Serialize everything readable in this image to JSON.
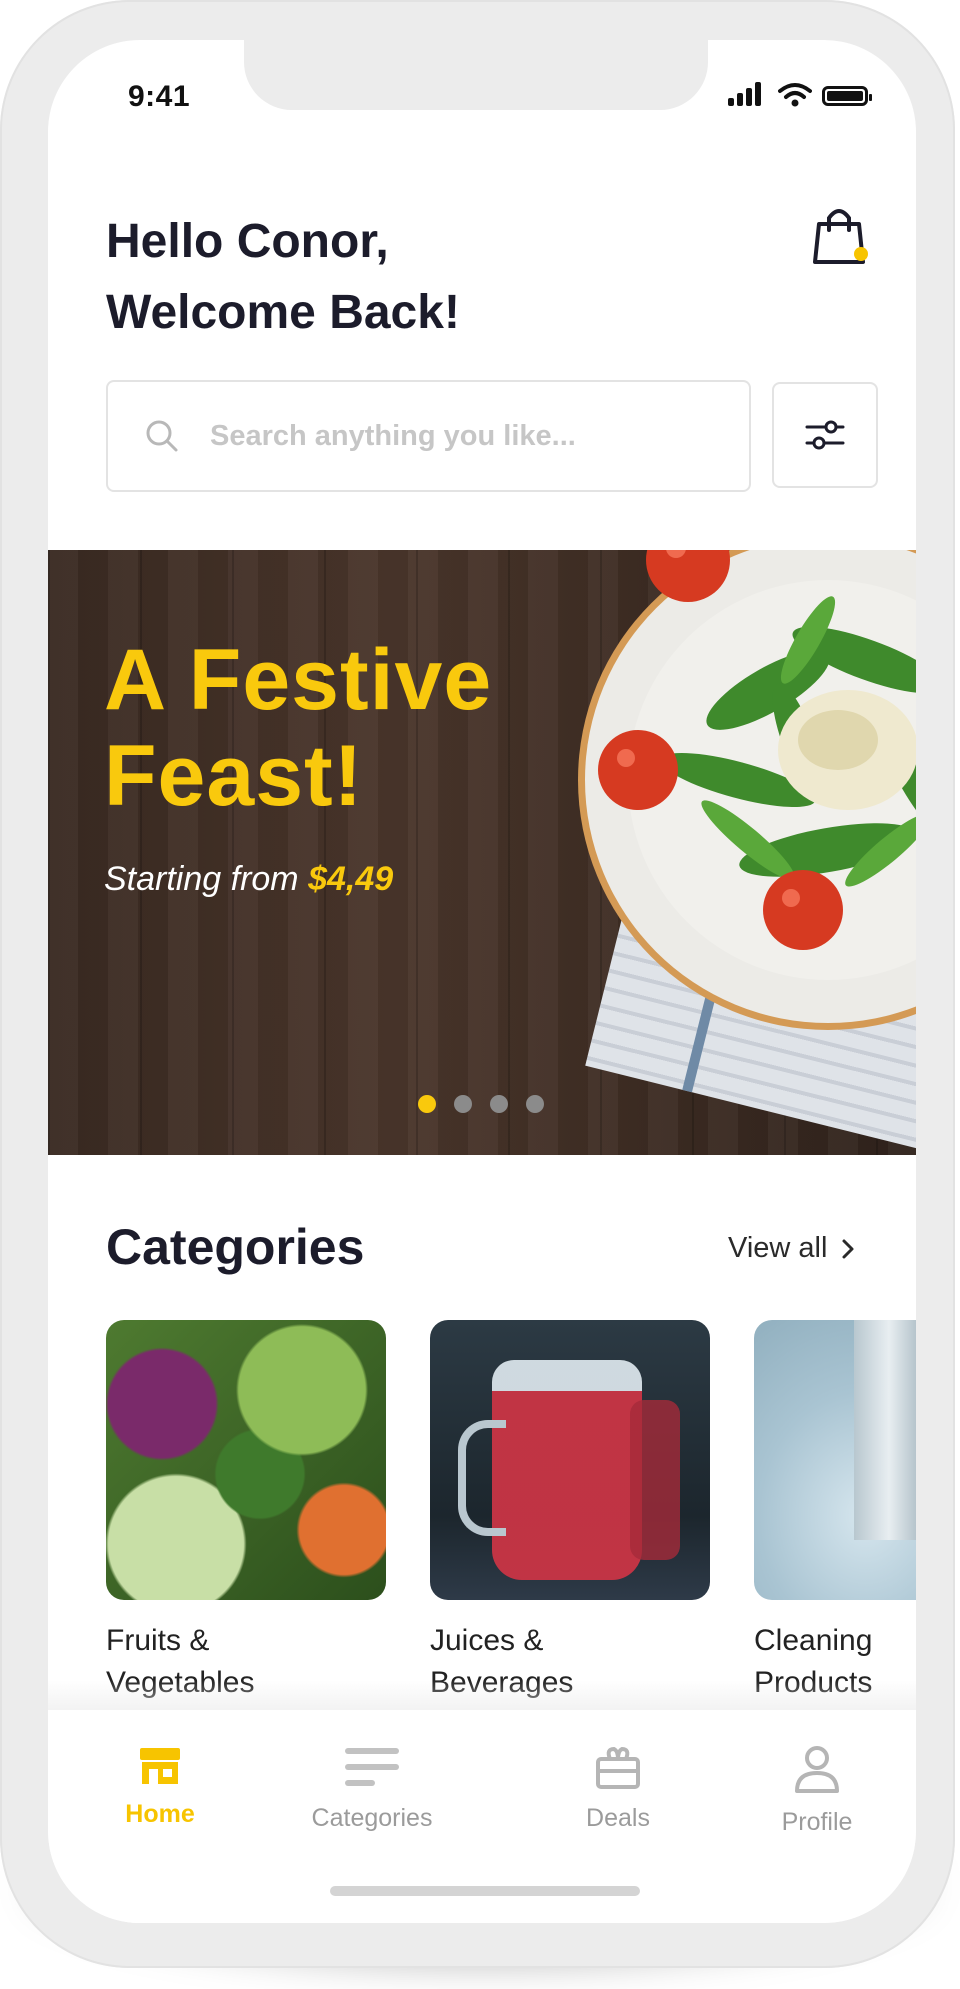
{
  "status_bar": {
    "time": "9:41"
  },
  "header": {
    "greeting_line1": "Hello Conor,",
    "greeting_line2": "Welcome Back!",
    "cart_icon": "shopping-bag-icon"
  },
  "search": {
    "placeholder": "Search anything you like...",
    "value": "",
    "filter_icon": "sliders-icon"
  },
  "banner": {
    "title_line1": "A Festive",
    "title_line2": "Feast!",
    "subtitle": "Starting from",
    "price": "$4,49",
    "slides": 4,
    "active_slide": 1
  },
  "categories": {
    "title": "Categories",
    "view_all": "View all",
    "items": [
      {
        "line1": "Fruits &",
        "line2": "Vegetables"
      },
      {
        "line1": "Juices &",
        "line2": "Beverages"
      },
      {
        "line1": "Cleaning",
        "line2": "Products"
      }
    ]
  },
  "tabbar": {
    "items": [
      {
        "label": "Home",
        "icon": "store-icon",
        "active": true
      },
      {
        "label": "Categories",
        "icon": "list-icon",
        "active": false
      },
      {
        "label": "Deals",
        "icon": "gift-icon",
        "active": false
      },
      {
        "label": "Profile",
        "icon": "user-icon",
        "active": false
      }
    ]
  },
  "colors": {
    "accent": "#f7c400",
    "text_dark": "#1c1c2b",
    "muted": "#9b9b9b"
  }
}
